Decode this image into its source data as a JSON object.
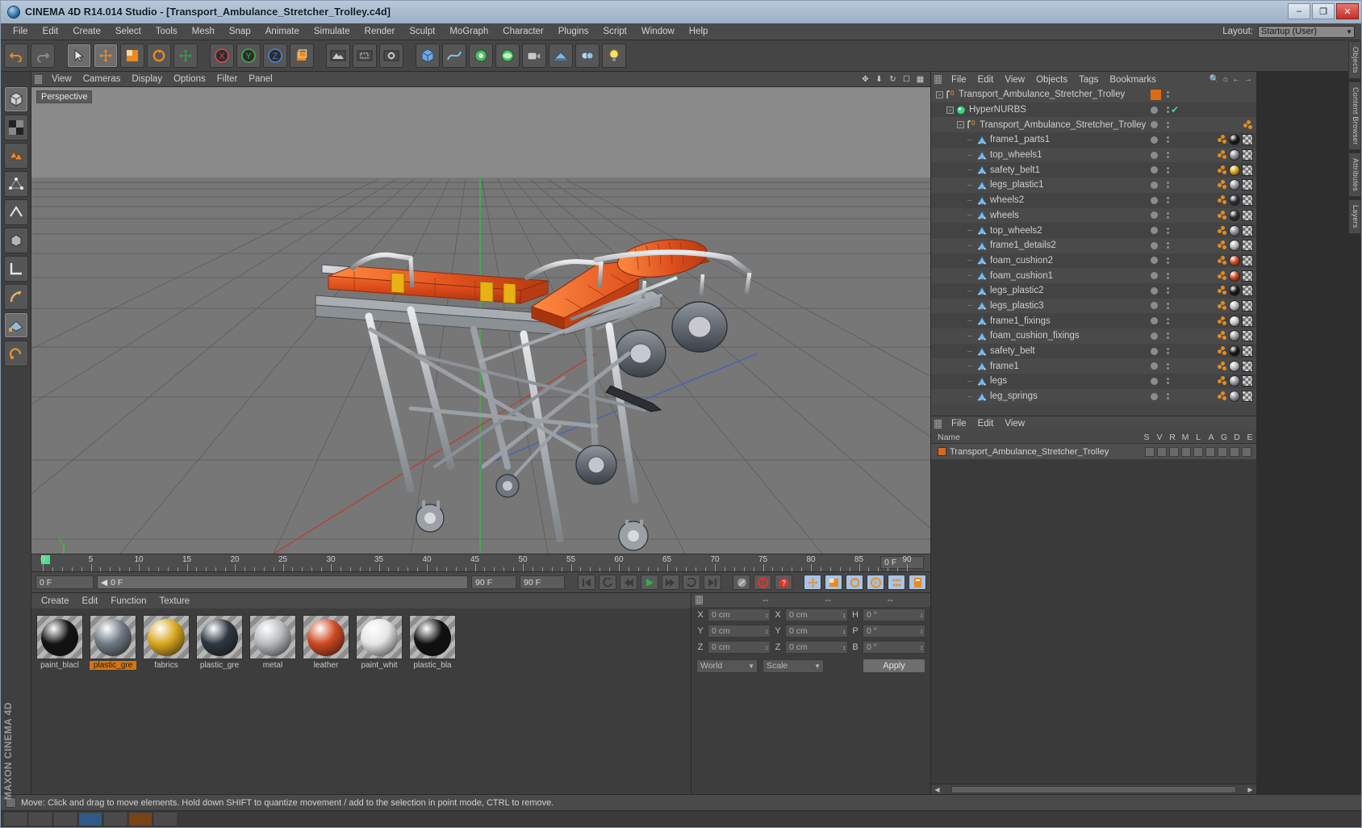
{
  "window": {
    "title": "CINEMA 4D R14.014 Studio - [Transport_Ambulance_Stretcher_Trolley.c4d]",
    "minimize": "–",
    "maximize": "❐",
    "close": "✕"
  },
  "menubar": {
    "items": [
      "File",
      "Edit",
      "Create",
      "Select",
      "Tools",
      "Mesh",
      "Snap",
      "Animate",
      "Simulate",
      "Render",
      "Sculpt",
      "MoGraph",
      "Character",
      "Plugins",
      "Script",
      "Window",
      "Help"
    ],
    "layout_label": "Layout:",
    "layout_value": "Startup (User)"
  },
  "viewport_menu": {
    "items": [
      "View",
      "Cameras",
      "Display",
      "Options",
      "Filter",
      "Panel"
    ],
    "label": "Perspective"
  },
  "timeline": {
    "ticks": [
      "0",
      "5",
      "10",
      "15",
      "20",
      "25",
      "30",
      "35",
      "40",
      "45",
      "50",
      "55",
      "60",
      "65",
      "70",
      "75",
      "80",
      "85",
      "90"
    ],
    "current_frame_field": "0 F",
    "start_field": "0 F",
    "scrub_value": "0 F",
    "end_field_a": "90 F",
    "end_field_b": "90 F"
  },
  "materials": {
    "menu": [
      "Create",
      "Edit",
      "Function",
      "Texture"
    ],
    "items": [
      {
        "name": "paint_blacl",
        "color": "#141414",
        "selected": false
      },
      {
        "name": "plastic_gre",
        "color": "#707a85",
        "selected": true
      },
      {
        "name": "fabrics",
        "color": "#d8a81f",
        "selected": false
      },
      {
        "name": "plastic_gre",
        "color": "#2e3740",
        "selected": false
      },
      {
        "name": "metal",
        "color": "#b9bcc0",
        "selected": false
      },
      {
        "name": "leather",
        "color": "#cf4a22",
        "selected": false
      },
      {
        "name": "paint_whit",
        "color": "#e6e6e6",
        "selected": false
      },
      {
        "name": "plastic_bla",
        "color": "#111111",
        "selected": false
      }
    ]
  },
  "coordinates": {
    "header_left": "--",
    "header_mid": "--",
    "header_right": "--",
    "rows": [
      {
        "axis1": "X",
        "val1": "0 cm",
        "axis2": "X",
        "val2": "0 cm",
        "axis3": "H",
        "val3": "0 °"
      },
      {
        "axis1": "Y",
        "val1": "0 cm",
        "axis2": "Y",
        "val2": "0 cm",
        "axis3": "P",
        "val3": "0 °"
      },
      {
        "axis1": "Z",
        "val1": "0 cm",
        "axis2": "Z",
        "val2": "0 cm",
        "axis3": "B",
        "val3": "0 °"
      }
    ],
    "system": "World",
    "mode": "Scale",
    "apply": "Apply"
  },
  "object_manager": {
    "menu": [
      "File",
      "Edit",
      "View",
      "Objects",
      "Tags",
      "Bookmarks"
    ],
    "rows": [
      {
        "label": "Transport_Ambulance_Stretcher_Trolley",
        "indent": 0,
        "icon": "null-object-icon",
        "expandable": true,
        "swatch": "#e06a13",
        "tags": []
      },
      {
        "label": "HyperNURBS",
        "indent": 1,
        "icon": "hypernurbs-icon",
        "expandable": true,
        "check": true,
        "tags": []
      },
      {
        "label": "Transport_Ambulance_Stretcher_Trolley",
        "indent": 2,
        "icon": "null-object-icon",
        "expandable": true,
        "tags": [
          "dots"
        ]
      },
      {
        "label": "frame1_parts1",
        "indent": 3,
        "icon": "polygon-object-icon",
        "tags": [
          "dots",
          "mat",
          "tex"
        ],
        "mat": "#171717"
      },
      {
        "label": "top_wheels1",
        "indent": 3,
        "icon": "polygon-object-icon",
        "tags": [
          "dots",
          "mat",
          "tex"
        ],
        "mat": "#8e949c"
      },
      {
        "label": "safety_belt1",
        "indent": 3,
        "icon": "polygon-object-icon",
        "tags": [
          "dots",
          "mat",
          "tex"
        ],
        "mat": "#d8a81f"
      },
      {
        "label": "legs_plastic1",
        "indent": 3,
        "icon": "polygon-object-icon",
        "tags": [
          "dots",
          "mat",
          "tex"
        ],
        "mat": "#9aa0a7"
      },
      {
        "label": "wheels2",
        "indent": 3,
        "icon": "polygon-object-icon",
        "tags": [
          "dots",
          "mat",
          "tex"
        ],
        "mat": "#2b3138"
      },
      {
        "label": "wheels",
        "indent": 3,
        "icon": "polygon-object-icon",
        "tags": [
          "dots",
          "mat",
          "tex"
        ],
        "mat": "#2b3138"
      },
      {
        "label": "top_wheels2",
        "indent": 3,
        "icon": "polygon-object-icon",
        "tags": [
          "dots",
          "mat",
          "tex"
        ],
        "mat": "#8e949c"
      },
      {
        "label": "frame1_details2",
        "indent": 3,
        "icon": "polygon-object-icon",
        "tags": [
          "dots",
          "mat",
          "tex"
        ],
        "mat": "#b9bcc0"
      },
      {
        "label": "foam_cushion2",
        "indent": 3,
        "icon": "polygon-object-icon",
        "tags": [
          "dots",
          "mat",
          "tex"
        ],
        "mat": "#cf4a22"
      },
      {
        "label": "foam_cushion1",
        "indent": 3,
        "icon": "polygon-object-icon",
        "tags": [
          "dots",
          "mat",
          "tex"
        ],
        "mat": "#cf4a22"
      },
      {
        "label": "legs_plastic2",
        "indent": 3,
        "icon": "polygon-object-icon",
        "tags": [
          "dots",
          "mat",
          "tex"
        ],
        "mat": "#171717"
      },
      {
        "label": "legs_plastic3",
        "indent": 3,
        "icon": "polygon-object-icon",
        "tags": [
          "dots",
          "mat",
          "tex"
        ],
        "mat": "#b9bcc0"
      },
      {
        "label": "frame1_fixings",
        "indent": 3,
        "icon": "polygon-object-icon",
        "tags": [
          "dots",
          "mat",
          "tex"
        ],
        "mat": "#c8ccd0"
      },
      {
        "label": "foam_cushion_fixings",
        "indent": 3,
        "icon": "polygon-object-icon",
        "tags": [
          "dots",
          "mat",
          "tex"
        ],
        "mat": "#9aa0a7"
      },
      {
        "label": "safety_belt",
        "indent": 3,
        "icon": "polygon-object-icon",
        "tags": [
          "dots",
          "mat",
          "tex"
        ],
        "mat": "#171717"
      },
      {
        "label": "frame1",
        "indent": 3,
        "icon": "polygon-object-icon",
        "tags": [
          "dots",
          "mat",
          "tex"
        ],
        "mat": "#b9bcc0"
      },
      {
        "label": "legs",
        "indent": 3,
        "icon": "polygon-object-icon",
        "tags": [
          "dots",
          "mat",
          "tex"
        ],
        "mat": "#9aa0a7"
      },
      {
        "label": "leg_springs",
        "indent": 3,
        "icon": "polygon-object-icon",
        "tags": [
          "dots",
          "mat",
          "tex"
        ],
        "mat": "#8e949c"
      }
    ]
  },
  "layer_manager": {
    "menu": [
      "File",
      "Edit",
      "View"
    ],
    "columns": [
      "Name",
      "S",
      "V",
      "R",
      "M",
      "L",
      "A",
      "G",
      "D",
      "E"
    ],
    "row_label": "Transport_Ambulance_Stretcher_Trolley",
    "row_color": "#d76b1c"
  },
  "right_tabs": [
    "Objects",
    "Content Browser",
    "Attributes",
    "Layers"
  ],
  "statusbar": {
    "text": "Move: Click and drag to move elements. Hold down SHIFT to quantize movement / add to the selection in point mode, CTRL to remove."
  },
  "watermark": "MAXON CINEMA 4D",
  "axis_gizmo": {
    "x": "X",
    "y": "Y",
    "z": "Z"
  }
}
